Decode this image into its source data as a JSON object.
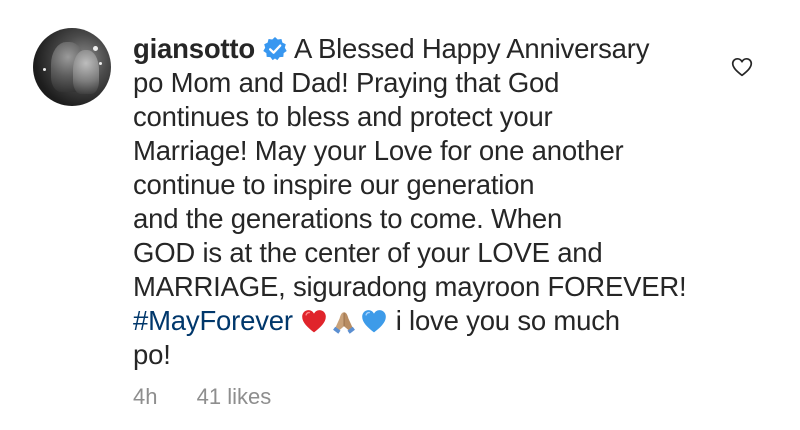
{
  "comment": {
    "username": "giansotto",
    "lines": [
      "A Blessed Happy Anniversary",
      "po Mom and Dad! Praying that God",
      "continues to bless and protect your",
      "Marriage! May your Love for one another",
      "continue to inspire our generation",
      "and the generations to come. When",
      "GOD is at the center of your LOVE and",
      "MARRIAGE, siguradong mayroon FOREVER!"
    ],
    "hashtag": "#MayForever",
    "after_emoji": "i love you so much",
    "last_line": "po!",
    "time_ago": "4h",
    "likes": "41 likes"
  },
  "icons": {
    "avatar": "profile-photo",
    "verified": "verified-badge-icon",
    "emojis": [
      "red-heart-emoji",
      "folded-hands-emoji",
      "blue-heart-emoji"
    ],
    "like": "heart-outline-icon"
  },
  "colors": {
    "text": "#262626",
    "hashtag": "#00376b",
    "meta": "#8e8e8e",
    "verified": "#3897f0",
    "red_heart": "#e0242b",
    "blue_heart": "#3d9be9"
  }
}
